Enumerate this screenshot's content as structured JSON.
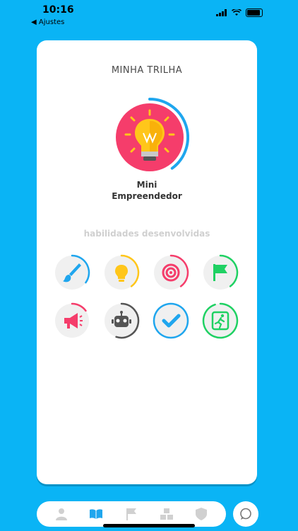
{
  "status": {
    "time": "10:16",
    "back_label": "◀ Ajustes"
  },
  "card": {
    "title": "MINHA TRILHA",
    "level": {
      "line1": "Mini",
      "line2": "Empreendedor",
      "progress": 0.4,
      "color": "#f53d6b"
    },
    "skills_title": "habilidades desenvolvidas",
    "skills": [
      {
        "name": "brush",
        "color": "#1fa6ee",
        "progress": 0.35
      },
      {
        "name": "lightbulb",
        "color": "#ffc61a",
        "progress": 0.4
      },
      {
        "name": "target",
        "color": "#f53d6b",
        "progress": 0.4
      },
      {
        "name": "flag",
        "color": "#1fd163",
        "progress": 0.4
      },
      {
        "name": "megaphone",
        "color": "#f53d6b",
        "progress": 0.15
      },
      {
        "name": "robot",
        "color": "#555555",
        "progress": 0.55
      },
      {
        "name": "check",
        "color": "#1fa6ee",
        "progress": 1.0
      },
      {
        "name": "runner",
        "color": "#1fd163",
        "progress": 0.95
      }
    ]
  },
  "nav": [
    "user-icon",
    "book-icon",
    "flag-icon",
    "blocks-icon",
    "shield-icon"
  ],
  "colors": {
    "background": "#0ab4f5",
    "active_nav": "#1fa6ee",
    "inactive_nav": "#d0d0d0"
  }
}
